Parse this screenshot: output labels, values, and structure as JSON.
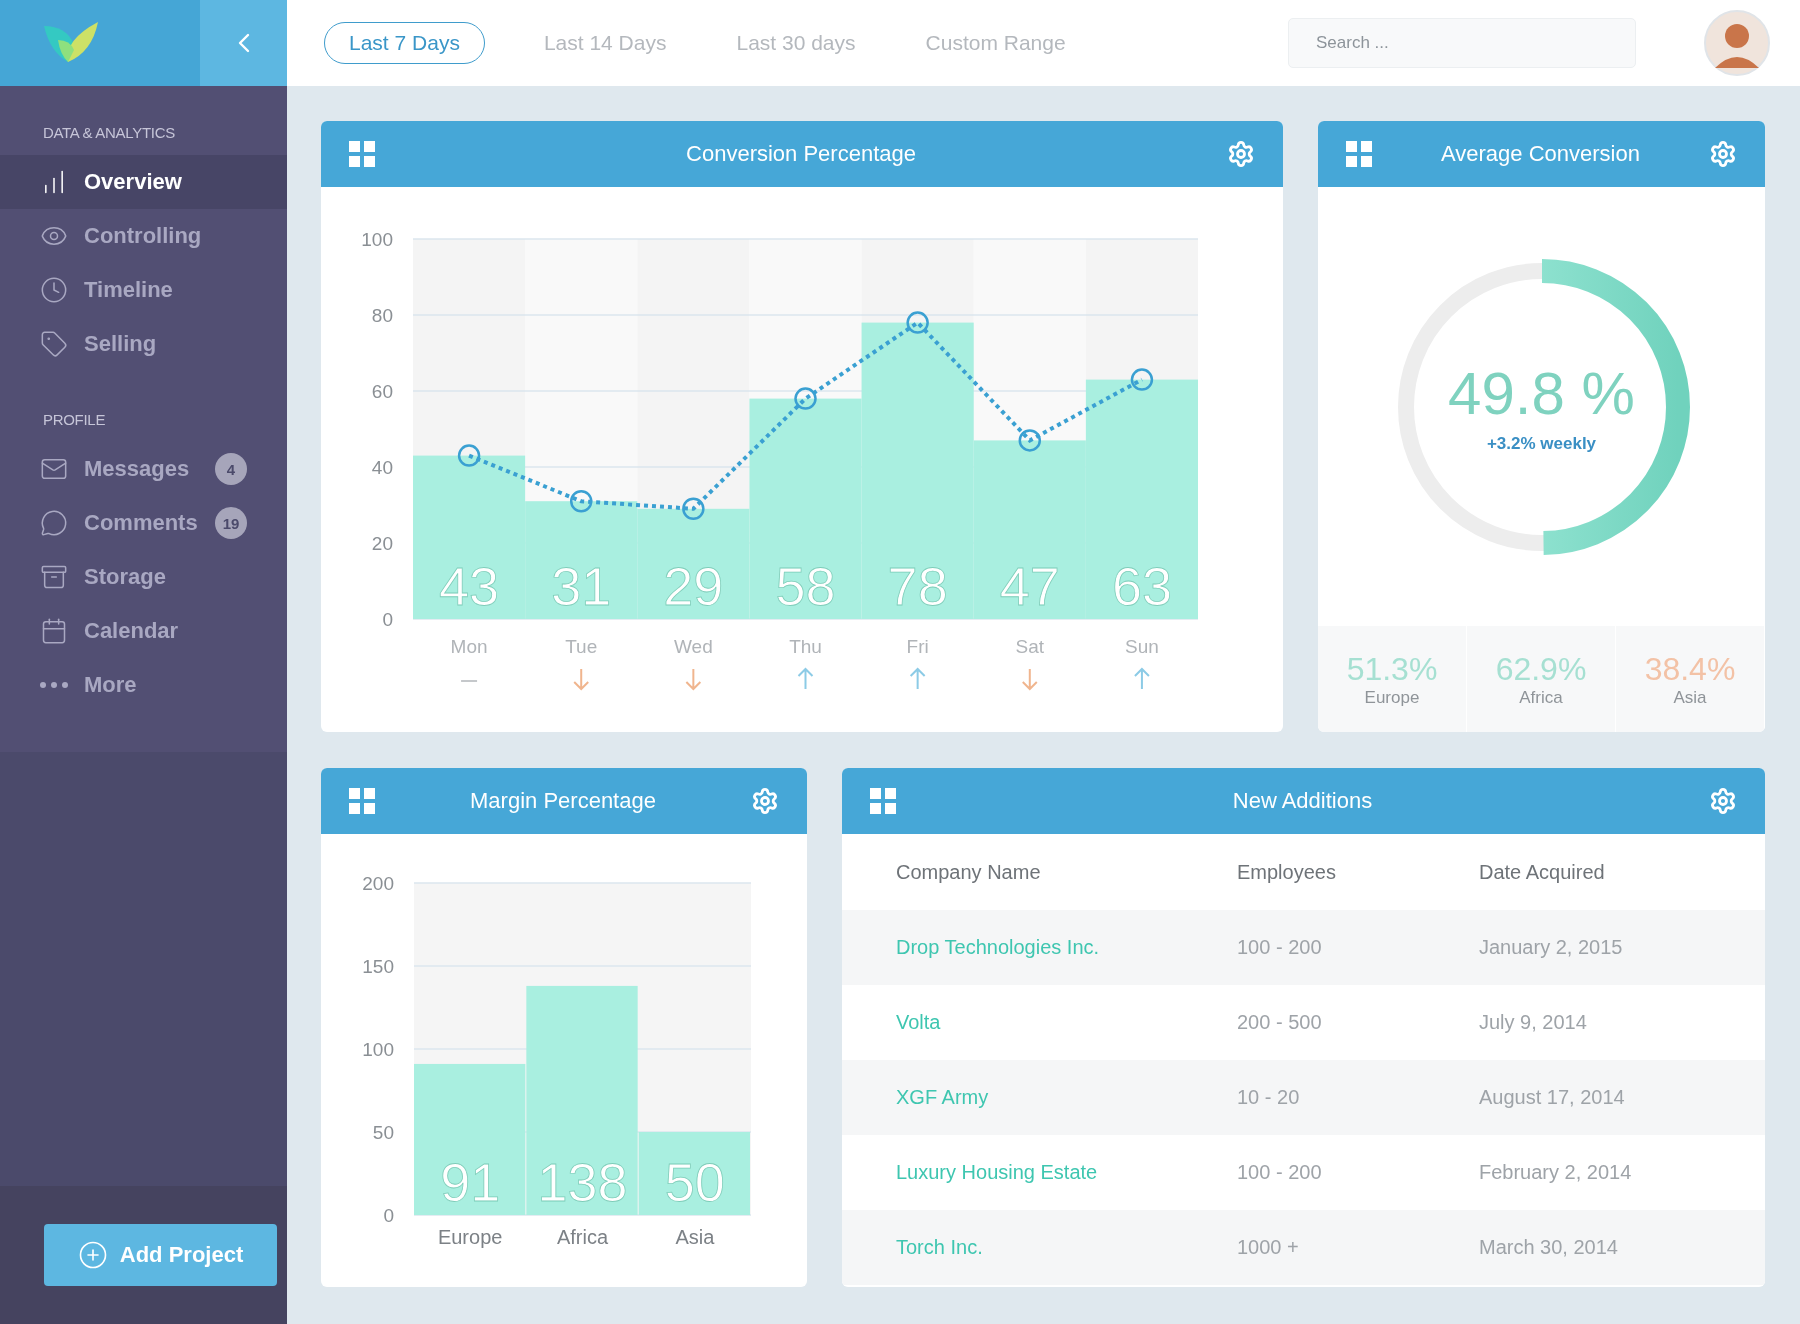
{
  "sidebar": {
    "sections": [
      {
        "heading": "DATA & ANALYTICS",
        "items": [
          {
            "label": "Overview",
            "kind": "chart",
            "selected": true
          },
          {
            "label": "Controlling",
            "kind": "eye",
            "selected": false
          },
          {
            "label": "Timeline",
            "kind": "clock",
            "selected": false
          },
          {
            "label": "Selling",
            "kind": "tag",
            "selected": false
          }
        ]
      },
      {
        "heading": "PROFILE",
        "items": [
          {
            "label": "Messages",
            "kind": "mail",
            "badge": "4",
            "selected": false
          },
          {
            "label": "Comments",
            "kind": "comment",
            "badge": "19",
            "selected": false
          },
          {
            "label": "Storage",
            "kind": "archive",
            "selected": false
          },
          {
            "label": "Calendar",
            "kind": "calendar",
            "selected": false
          },
          {
            "label": "More",
            "kind": "more",
            "selected": false
          }
        ]
      }
    ],
    "add_button": "Add Project"
  },
  "ranges": [
    {
      "label": "Last 7 Days",
      "selected": true
    },
    {
      "label": "Last 14 Days",
      "selected": false
    },
    {
      "label": "Last 30 days",
      "selected": false
    },
    {
      "label": "Custom Range",
      "selected": false
    }
  ],
  "search": {
    "placeholder": "Search ..."
  },
  "conversion": {
    "title": "Conversion Percentage",
    "trends": [
      {
        "kind": "flat"
      },
      {
        "kind": "down"
      },
      {
        "kind": "down"
      },
      {
        "kind": "up"
      },
      {
        "kind": "up"
      },
      {
        "kind": "down"
      },
      {
        "kind": "up"
      }
    ],
    "chart_data": {
      "type": "bar",
      "categories": [
        "Mon",
        "Tue",
        "Wed",
        "Thu",
        "Fri",
        "Sat",
        "Sun"
      ],
      "series": [
        {
          "color": "#a9efe0",
          "values": [
            43,
            31,
            29,
            58,
            78,
            47,
            63
          ]
        }
      ],
      "ylim": [
        0,
        100
      ],
      "yticks": [
        0,
        20,
        40,
        60,
        80,
        100
      ],
      "grid": true,
      "data_labels": true
    }
  },
  "average": {
    "title": "Average Conversion",
    "value": "49.8 %",
    "change": "+3.2% weekly",
    "level": 0.498,
    "regions": [
      {
        "value": "51.3%",
        "label": "Europe",
        "color": "#a6e0d2"
      },
      {
        "value": "62.9%",
        "label": "Africa",
        "color": "#a6e0d2"
      },
      {
        "value": "38.4%",
        "label": "Asia",
        "color": "#f3c2a6"
      }
    ]
  },
  "margin": {
    "title": "Margin Percentage",
    "chart_data": {
      "type": "bar",
      "categories": [
        "Europe",
        "Africa",
        "Asia"
      ],
      "series": [
        {
          "color": "#a9efe0",
          "values": [
            91,
            138,
            50
          ]
        }
      ],
      "ylim": [
        0,
        200
      ],
      "yticks": [
        0,
        50,
        100,
        150,
        200
      ],
      "grid": true,
      "data_labels": true
    }
  },
  "additions": {
    "title": "New Additions",
    "columns": [
      "Company Name",
      "Employees",
      "Date Acquired"
    ],
    "rows": [
      [
        "Drop Technologies Inc.",
        "100 - 200",
        "January 2, 2015"
      ],
      [
        "Volta",
        "200 - 500",
        "July 9, 2014"
      ],
      [
        "XGF Army",
        "10 - 20",
        "August 17, 2014"
      ],
      [
        "Luxury Housing Estate",
        "100 - 200",
        "February 2, 2014"
      ],
      [
        "Torch Inc.",
        "1000 +",
        "March 30, 2014"
      ]
    ]
  }
}
